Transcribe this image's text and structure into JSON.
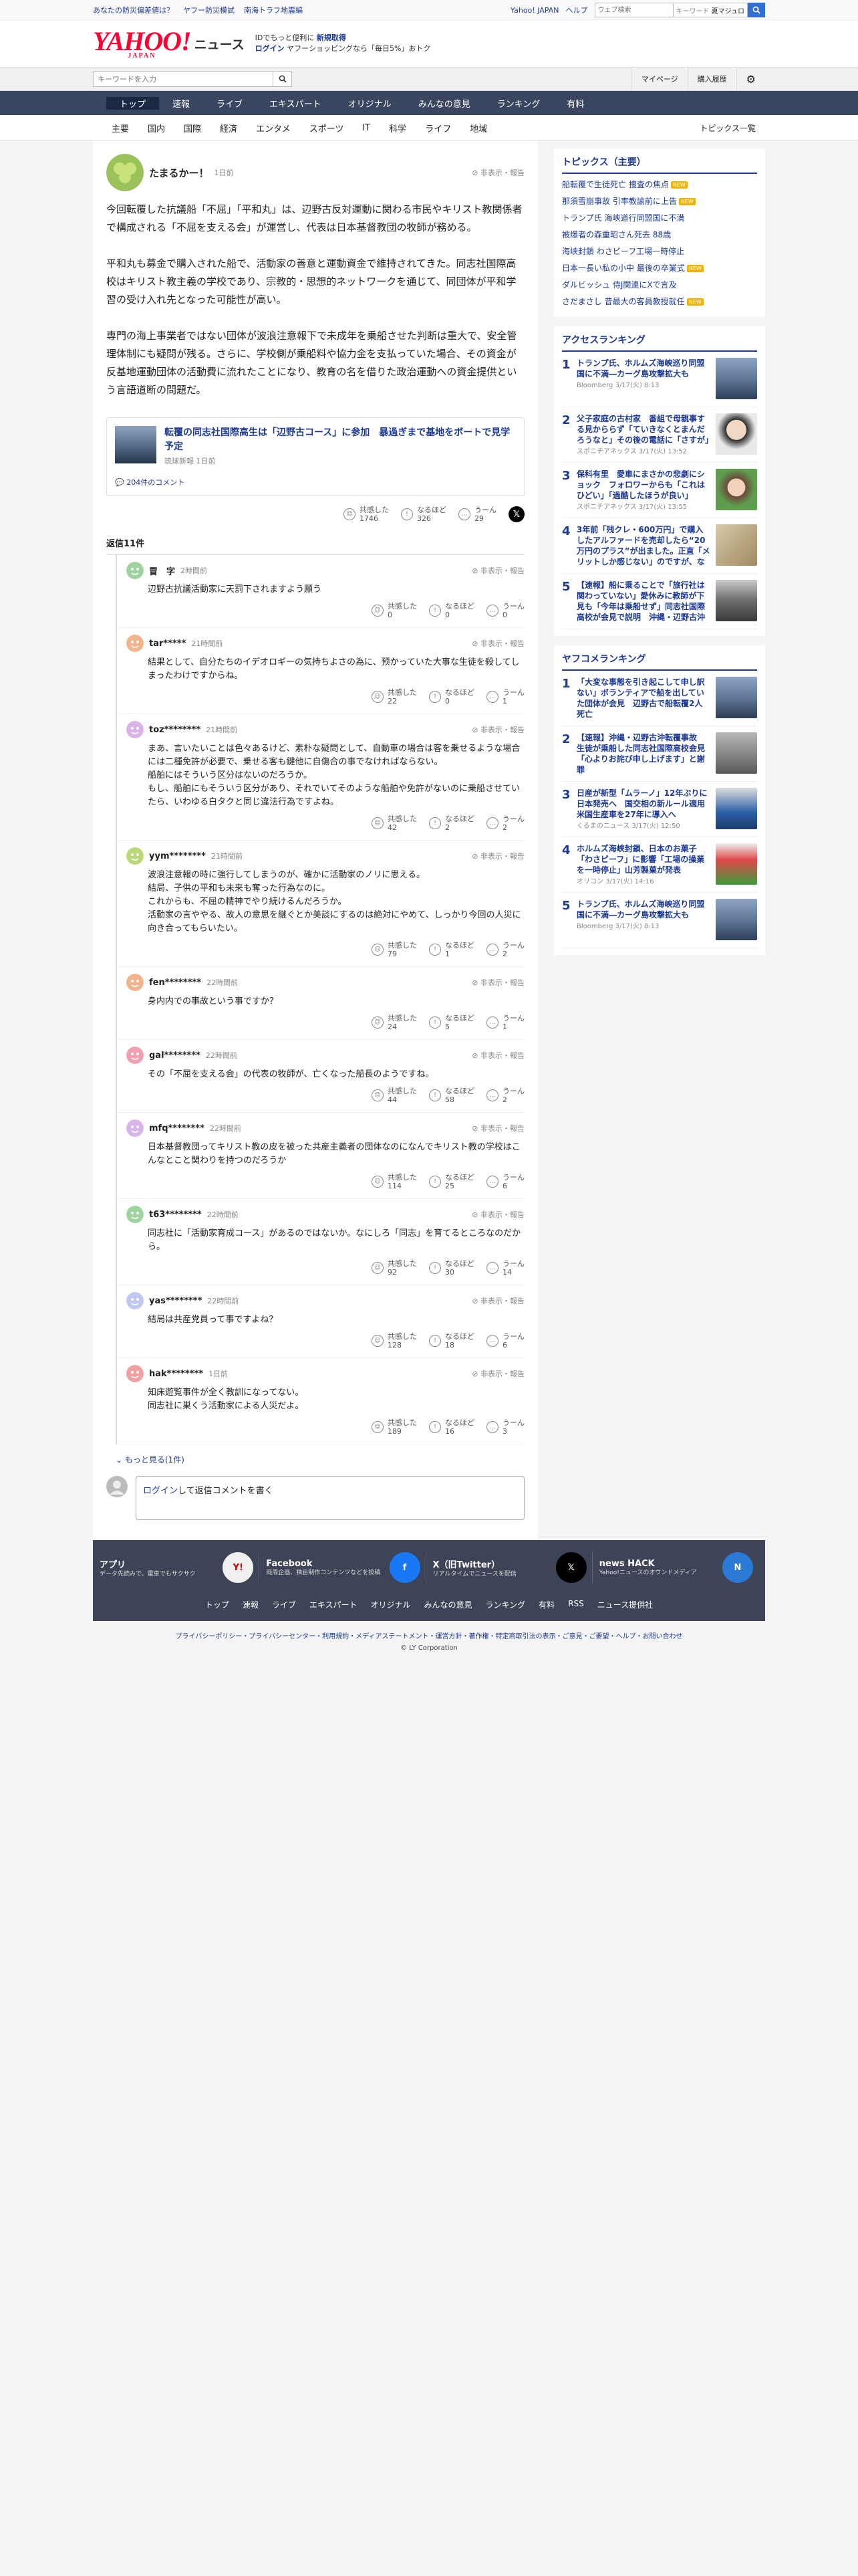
{
  "topbar": {
    "links": [
      "あなたの防災偏差値は？",
      "ヤフー防災模試",
      "南海トラフ地震編"
    ],
    "right": [
      "Yahoo! JAPAN",
      "ヘルプ"
    ],
    "search_placeholder": "ウェブ検索",
    "keyword": "キーワード",
    "keyword_pill": "夏マジュロ"
  },
  "header": {
    "logo": "YAHOO!",
    "logo_sub": "JAPAN",
    "brand": "ニュース",
    "promo1": "IDでもっと便利に",
    "promo1b": "新規取得",
    "promo2a": "ログイン",
    "promo2b": "ヤフーショッピングなら「毎日5%」おトク"
  },
  "subbar": {
    "search_placeholder": "キーワードを入力",
    "mypage": "マイページ",
    "history": "購入履歴"
  },
  "mainnav": [
    "トップ",
    "速報",
    "ライブ",
    "エキスパート",
    "オリジナル",
    "みんなの意見",
    "ランキング",
    "有料"
  ],
  "catnav": [
    "主要",
    "国内",
    "国際",
    "経済",
    "エンタメ",
    "スポーツ",
    "IT",
    "科学",
    "ライフ",
    "地域"
  ],
  "catnav_all": "トピックス一覧",
  "comment": {
    "user": "たまるかー！",
    "time": "1日前",
    "report": "非表示・報告",
    "paragraphs": [
      "今回転覆した抗議船「不屈」「平和丸」は、辺野古反対運動に関わる市民やキリスト教関係者で構成される「不屈を支える会」が運営し、代表は日本基督教団の牧師が務める。",
      "平和丸も募金で購入された船で、活動家の善意と運動資金で維持されてきた。同志社国際高校はキリスト教主義の学校であり、宗教的・思想的ネットワークを通じて、同団体が平和学習の受け入れ先となった可能性が高い。",
      "専門の海上事業者ではない団体が波浪注意報下で未成年を乗船させた判断は重大で、安全管理体制にも疑問が残る。さらに、学校側が乗船料や協力金を支払っていた場合、その資金が反基地運動団体の活動費に流れたことになり、教育の名を借りた政治運動への資金提供という言語道断の問題だ。"
    ],
    "embed": {
      "title": "転覆の同志社国際高生は「辺野古コース」に参加　暴過ぎまで基地をボートで見学予定",
      "source": "琉球新報",
      "time": "1日前",
      "comments": "204件のコメント"
    },
    "reactions": {
      "kyokan": "共感した",
      "kyokan_n": "1746",
      "naruhodo": "なるほど",
      "naruhodo_n": "326",
      "uun": "うーん",
      "uun_n": "29"
    }
  },
  "replies_title": "返信11件",
  "replies": [
    {
      "user": "冒　字",
      "time": "2時間前",
      "text": "辺野古抗議活動家に天罰下されますよう願う",
      "k": "0",
      "n": "0",
      "u": "0"
    },
    {
      "user": "tar*****",
      "time": "21時間前",
      "text": "結果として、自分たちのイデオロギーの気持ちよさの為に、预かっていた大事な生徒を殺してしまったわけですからね。",
      "k": "22",
      "n": "0",
      "u": "1"
    },
    {
      "user": "toz********",
      "time": "21時間前",
      "text": "まあ、言いたいことは色々あるけど、素朴な疑問として、自動車の場合は客を乗せるような場合には二種免許が必要で、乗せる客も鍵他に自傷合の事でなければならない。\n船舶にはそういう区分はないのだろうか。\nもし、船舶にもそういう区分があり、それでいてそのような船舶や免許がないのに乗船させていたら、いわゆる白タクと同じ違法行為ですよね。",
      "k": "42",
      "n": "2",
      "u": "2"
    },
    {
      "user": "yym********",
      "time": "21時間前",
      "text": "波浪注意報の時に強行してしまうのが、確かに活動家のノリに思える。\n結局、子供の平和も未来も奪った行為なのに。\nこれからも、不屈の精神でやり続けるんだろうか。\n活動家の言ややる、故人の意思を継ぐとか美談にするのは絶対にやめて、しっかり今回の人災に向き合ってもらいたい。",
      "k": "79",
      "n": "1",
      "u": "2"
    },
    {
      "user": "fen********",
      "time": "22時間前",
      "text": "身内内での事故という事ですか？",
      "k": "24",
      "n": "5",
      "u": "1"
    },
    {
      "user": "gal********",
      "time": "22時間前",
      "text": "その「不屈を支える会」の代表の牧師が、亡くなった船長のようですね。",
      "k": "44",
      "n": "58",
      "u": "2"
    },
    {
      "user": "mfq********",
      "time": "22時間前",
      "text": "日本基督教団ってキリスト教の皮を被った共産主義者の団体なのになんでキリスト教の学校はこんなとこと関わりを持つのだろうか",
      "k": "114",
      "n": "25",
      "u": "6"
    },
    {
      "user": "t63********",
      "time": "22時間前",
      "text": "同志社に「活動家育成コース」があるのではないか。なにしろ「同志」を育てるところなのだから。",
      "k": "92",
      "n": "30",
      "u": "14"
    },
    {
      "user": "yas********",
      "time": "22時間前",
      "text": "結局は共産党員って事ですよね？",
      "k": "128",
      "n": "18",
      "u": "6"
    },
    {
      "user": "hak********",
      "time": "1日前",
      "text": "知床遊覧事件が全く教訓になってない。\n同志社に巣くう活動家による人災だよ。",
      "k": "189",
      "n": "16",
      "u": "3"
    }
  ],
  "more": "もっと見る(1件)",
  "reply_input": {
    "login": "ログイン",
    "rest": "して返信コメントを書く"
  },
  "topics": {
    "title": "トピックス（主要）",
    "items": [
      {
        "t": "船転覆で生徒死亡 捜査の焦点",
        "new": true
      },
      {
        "t": "那須雪崩事故 引率教諭前に上告",
        "new": true
      },
      {
        "t": "トランプ氏 海峡道行同盟国に不満",
        "new": false
      },
      {
        "t": "被爆者の森重昭さん死去 88歳",
        "new": false
      },
      {
        "t": "海峡封鎖 わさビーフ工場一時停止",
        "new": false
      },
      {
        "t": "日本一長い私の小中 最後の卒業式",
        "new": true
      },
      {
        "t": "ダルビッシュ 侍J関連にXで言及",
        "new": false
      },
      {
        "t": "さだまさし 昔最大の客員教授就任",
        "new": true
      }
    ]
  },
  "access": {
    "title": "アクセスランキング",
    "items": [
      {
        "t": "トランプ氏、ホルムズ海峡巡り同盟国に不満―カーグ島攻撃拡大も",
        "s": "Bloomberg 3/17(火) 8:13"
      },
      {
        "t": "父子家庭の古村家　番組で母親事する見かららず「ていきなくとまんだろうなと」その後の電話に「さすが」",
        "s": "スポニチアネックス 3/17(火) 13:52"
      },
      {
        "t": "保科有里　愛車にまさかの悲劇にショック　フォロワーからも「これはひどい」「過酷したほうが良い」",
        "s": "スポニチアネックス 3/17(火) 13:55"
      },
      {
        "t": "3年前「残クレ・600万円」で購入したアルファードを売却したら“20万円のプラス”が出ました。正直「メリットしか感じない」のですが、なぜ“残クレアルファード”は批判されるのでしょうか？",
        "s": "ファイナンシャルフィールド 3/17(火) 13:40"
      },
      {
        "t": "【速報】船に乗ることで「旅行社は関わっていない」愛休みに教師が下見も「今年は乗船せず」同志社国際高校が会見で説明　沖縄・辺野古沖で船が転覆　修学旅行中の女子生徒が死亡",
        "s": "関西テレビ 3/17(火) 12:48"
      }
    ]
  },
  "yahuko": {
    "title": "ヤフコメランキング",
    "items": [
      {
        "t": "「大変な事態を引き起こして申し訳ない」ボランティアで船を出していた団体が会見　辺野古で船転覆2人死亡",
        "s": "RBC琉球放送 3/17(火) 10:23"
      },
      {
        "t": "【速報】沖縄・辺野古沖転覆事故　生徒が乗船した同志社国際高校会見「心よりお詫び申し上げます」と謝罪",
        "s": "京都新聞 3/17(火) 11:15"
      },
      {
        "t": "日産が新型「ムラーノ」12年ぶりに日本発売へ　国交相の新ルール適用　米国生産車を27年に導入へ",
        "s": "くるまのニュース 3/17(火) 12:50"
      },
      {
        "t": "ホルムズ海峡封鎖、日本のお菓子「わさビーフ」に影響「工場の操業を一時停止」山芳製菓が発表",
        "s": "オリコン 3/17(火) 14:16"
      },
      {
        "t": "トランプ氏、ホルムズ海峡巡り同盟国に不満―カーグ島攻撃拡大も",
        "s": "Bloomberg 3/17(火) 8:13"
      }
    ]
  },
  "footer": {
    "apps": [
      {
        "t": "アプリ",
        "d": "データ先読みで、電車でもサクサク"
      },
      {
        "t": "Facebook",
        "d": "両周企画、独自制作コンテンツなどを投稿"
      },
      {
        "t": "X（旧Twitter）",
        "d": "リアルタイムでニュースを配信"
      },
      {
        "t": "news HACK",
        "d": "Yahoo!ニュースのオウンドメディア"
      }
    ],
    "nav": [
      "トップ",
      "速報",
      "ライブ",
      "エキスパート",
      "オリジナル",
      "みんなの意見",
      "ランキング",
      "有料",
      "RSS",
      "ニュース提供社"
    ],
    "legal": "プライバシーポリシー・プライバシーセンター・利用規約・メディアステートメント・運営方針・著作権・特定商取引法の表示・ご意見・ご要望・ヘルプ・お問い合わせ",
    "copy": "© LY Corporation"
  },
  "colors": {
    "accent": "#1d3994",
    "nav": "#3a4660",
    "brand": "#ff0033"
  }
}
